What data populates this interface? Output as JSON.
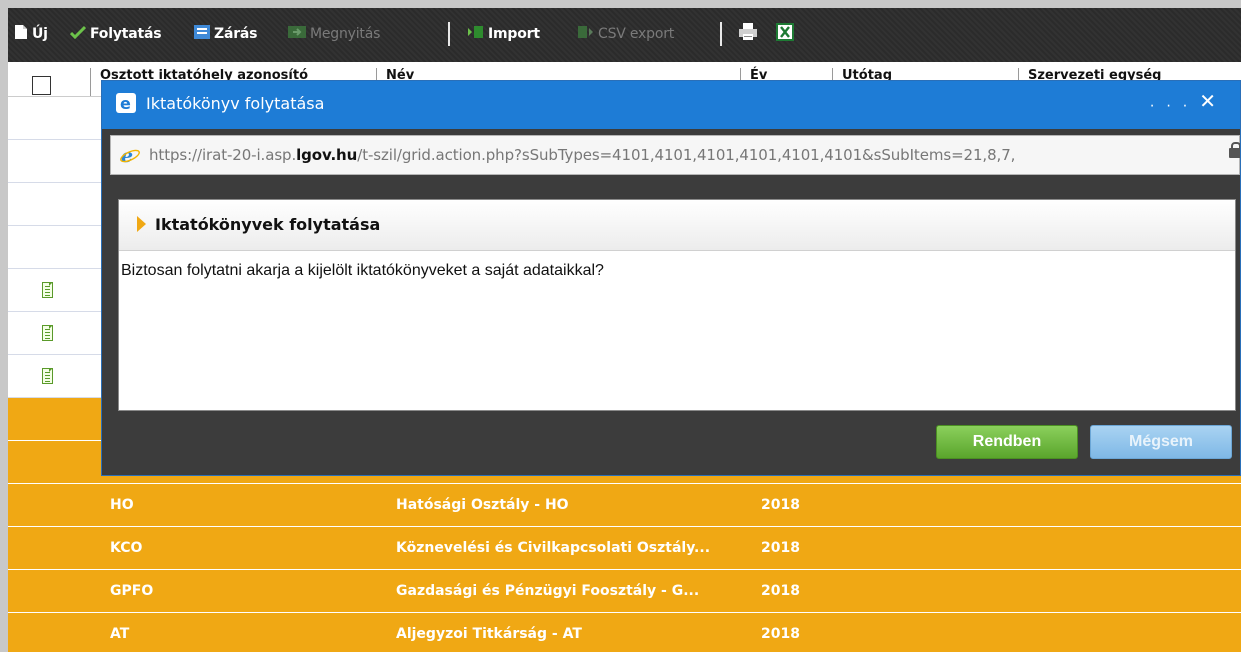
{
  "colors": {
    "toolbar_bg": "#2b2b2b",
    "modal_title_bg": "#1e7cd6",
    "row_highlight": "#f0a814",
    "ok_button": "#5aa52c",
    "cancel_button": "#7fb8e6"
  },
  "toolbar": {
    "new_label": "Új",
    "continue_label": "Folytatás",
    "close_label": "Zárás",
    "open_label": "Megnyitás",
    "import_label": "Import",
    "csv_export_label": "CSV export"
  },
  "grid": {
    "headers": [
      "Osztott iktatóhely azonosító",
      "Név",
      "Év",
      "Utótag",
      "Szervezeti egység"
    ],
    "rows": [
      {
        "code": "HO",
        "name": "Hatósági Osztály - HO",
        "year": "2018"
      },
      {
        "code": "KCO",
        "name": "Köznevelési és Civilkapcsolati Osztály...",
        "year": "2018"
      },
      {
        "code": "GPFO",
        "name": "Gazdasági és Pénzügyi Foosztály - G...",
        "year": "2018"
      },
      {
        "code": "AT",
        "name": "Aljegyzoi Titkárság - AT",
        "year": "2018"
      }
    ]
  },
  "modal": {
    "window_title": "Iktatókönyv folytatása",
    "window_controls": "...",
    "close_glyph": "✕",
    "url_prefix": "https://irat-20-i.asp.",
    "url_domain": "lgov.hu",
    "url_rest": "/t-szil/grid.action.php?sSubTypes=4101,4101,4101,4101,4101,4101&sSubItems=21,8,7,",
    "panel_title": "Iktatókönyvek folytatása",
    "message": "Biztosan folytatni akarja a kijelölt iktatókönyveket a saját adataikkal?",
    "ok_label": "Rendben",
    "cancel_label": "Mégsem"
  }
}
